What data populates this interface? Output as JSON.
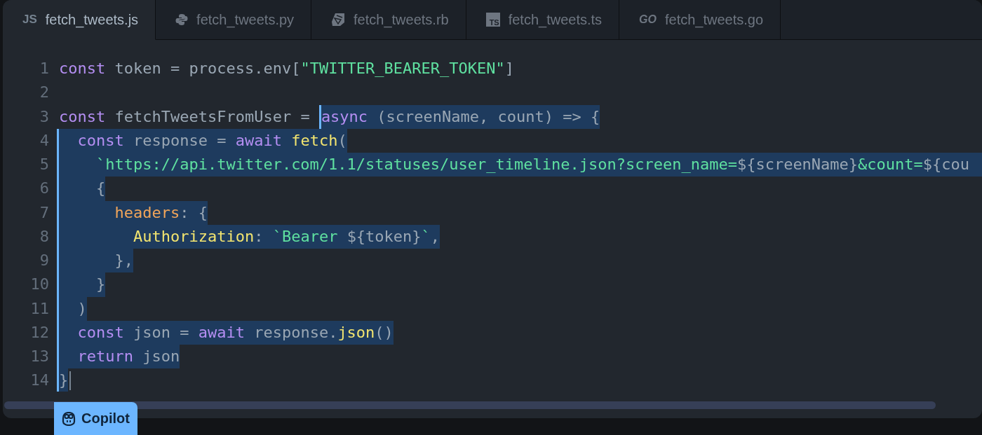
{
  "tabs": [
    {
      "label": "fetch_tweets.js",
      "selected": true,
      "badge": "JS"
    },
    {
      "label": "fetch_tweets.py",
      "selected": false
    },
    {
      "label": "fetch_tweets.rb",
      "selected": false
    },
    {
      "label": "fetch_tweets.ts",
      "selected": false,
      "badge": "TS"
    },
    {
      "label": "fetch_tweets.go",
      "selected": false,
      "badge": "GO"
    }
  ],
  "lines": [
    {
      "number": "1",
      "marked": false,
      "cut": false,
      "tokens": [
        {
          "kind": "keyword",
          "text": "const",
          "selected": false
        },
        {
          "kind": "plain",
          "text": " token = process.env[",
          "selected": false
        },
        {
          "kind": "string",
          "text": "\"TWITTER_BEARER_TOKEN\"",
          "selected": false
        },
        {
          "kind": "plain",
          "text": "]",
          "selected": false
        }
      ]
    },
    {
      "number": "2",
      "marked": false,
      "cut": false
    },
    {
      "number": "3",
      "marked": false,
      "cut": false,
      "tokens": [
        {
          "kind": "keyword",
          "text": "const",
          "selected": false
        },
        {
          "kind": "plain",
          "text": " fetchTweetsFromUser = ",
          "selected": false
        },
        {
          "kind": "marker"
        },
        {
          "kind": "keyword",
          "text": "async",
          "selected": true
        },
        {
          "kind": "plain",
          "text": " (screenName, count) => {",
          "selected": true
        }
      ]
    },
    {
      "number": "4",
      "marked": true,
      "cut": false,
      "tokens": [
        {
          "kind": "keyword",
          "text": "  const",
          "selected": true
        },
        {
          "kind": "plain",
          "text": " response = ",
          "selected": true
        },
        {
          "kind": "keyword",
          "text": "await",
          "selected": true
        },
        {
          "kind": "function",
          "text": " fetch",
          "selected": true
        },
        {
          "kind": "plain",
          "text": "(",
          "selected": true
        }
      ]
    },
    {
      "number": "5",
      "marked": true,
      "cut": true,
      "tokens": [
        {
          "kind": "string",
          "text": "    `https://api.twitter.com/1.1/statuses/user_timeline.json?screen_name=",
          "selected": true
        },
        {
          "kind": "plain",
          "text": "${screenName}",
          "selected": true
        },
        {
          "kind": "string",
          "text": "&count=",
          "selected": true
        },
        {
          "kind": "plain",
          "text": "${cou",
          "selected": true
        }
      ]
    },
    {
      "number": "6",
      "marked": true,
      "cut": false,
      "tokens": [
        {
          "kind": "plain",
          "text": "    {",
          "selected": true
        }
      ]
    },
    {
      "number": "7",
      "marked": true,
      "cut": false,
      "tokens": [
        {
          "kind": "property",
          "text": "      headers",
          "selected": true
        },
        {
          "kind": "plain",
          "text": ": {",
          "selected": true
        }
      ]
    },
    {
      "number": "8",
      "marked": true,
      "cut": false,
      "tokens": [
        {
          "kind": "function",
          "text": "        Authorization",
          "selected": true
        },
        {
          "kind": "plain",
          "text": ": ",
          "selected": true
        },
        {
          "kind": "string",
          "text": "`Bearer ",
          "selected": true
        },
        {
          "kind": "plain",
          "text": "${token}",
          "selected": true
        },
        {
          "kind": "string",
          "text": "`",
          "selected": true
        },
        {
          "kind": "plain",
          "text": ",",
          "selected": true
        }
      ]
    },
    {
      "number": "9",
      "marked": true,
      "cut": false,
      "tokens": [
        {
          "kind": "plain",
          "text": "      },",
          "selected": true
        }
      ]
    },
    {
      "number": "10",
      "marked": true,
      "cut": false,
      "tokens": [
        {
          "kind": "plain",
          "text": "    }",
          "selected": true
        }
      ]
    },
    {
      "number": "11",
      "marked": true,
      "cut": false,
      "tokens": [
        {
          "kind": "plain",
          "text": "  )",
          "selected": true
        }
      ]
    },
    {
      "number": "12",
      "marked": true,
      "cut": false,
      "tokens": [
        {
          "kind": "keyword",
          "text": "  const",
          "selected": true
        },
        {
          "kind": "plain",
          "text": " json = ",
          "selected": true
        },
        {
          "kind": "keyword",
          "text": "await",
          "selected": true
        },
        {
          "kind": "plain",
          "text": " response.",
          "selected": true
        },
        {
          "kind": "function",
          "text": "json",
          "selected": true
        },
        {
          "kind": "plain",
          "text": "()",
          "selected": true
        }
      ]
    },
    {
      "number": "13",
      "marked": true,
      "cut": false,
      "tokens": [
        {
          "kind": "keyword",
          "text": "  return",
          "selected": true
        },
        {
          "kind": "plain",
          "text": " json",
          "selected": true
        }
      ]
    },
    {
      "number": "14",
      "marked": true,
      "cut": false,
      "tokens": [
        {
          "kind": "plain",
          "text": "}",
          "selected": true
        },
        {
          "kind": "caret"
        }
      ]
    }
  ],
  "copilot": {
    "label": "Copilot"
  }
}
